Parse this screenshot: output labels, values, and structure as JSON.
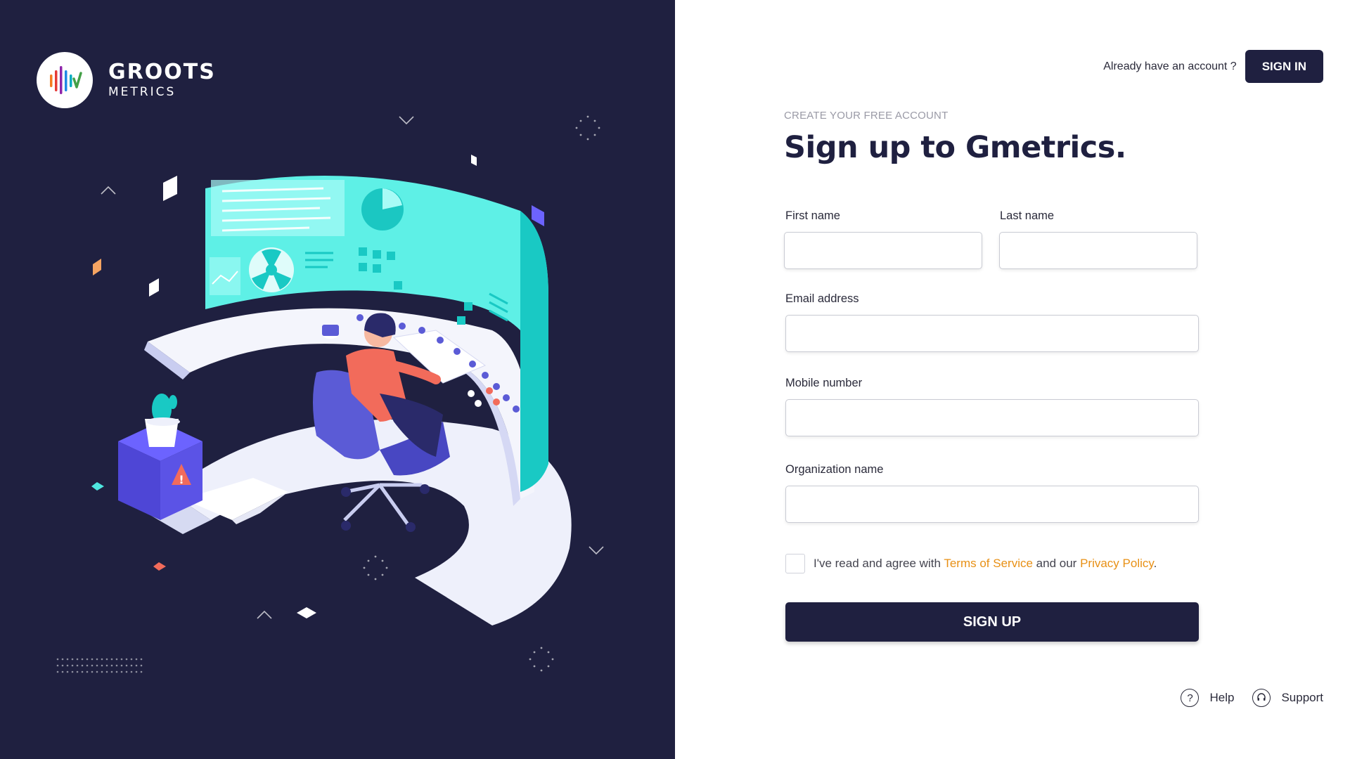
{
  "brand": {
    "name": "GROOTS",
    "sub": "METRICS",
    "colors": {
      "dark": "#1f2040",
      "accent": "#e89015",
      "cyan": "#4fe6e0"
    }
  },
  "header": {
    "already_text": "Already have an account ?",
    "signin_label": "SIGN IN"
  },
  "form": {
    "eyebrow": "CREATE YOUR FREE ACCOUNT",
    "title": "Sign up to Gmetrics.",
    "first_name_label": "First name",
    "last_name_label": "Last name",
    "email_label": "Email address",
    "mobile_label": "Mobile number",
    "org_label": "Organization name",
    "first_name_value": "",
    "last_name_value": "",
    "email_value": "",
    "mobile_value": "",
    "org_value": "",
    "agree_prefix": "I've read and agree with",
    "terms_link": "Terms of Service",
    "agree_mid": "and our",
    "privacy_link": "Privacy Policy",
    "agree_suffix": ".",
    "agree_checked": false,
    "signup_label": "SIGN UP"
  },
  "footer": {
    "help_label": "Help",
    "help_icon": "question-circle-icon",
    "support_label": "Support",
    "support_icon": "headset-icon"
  }
}
